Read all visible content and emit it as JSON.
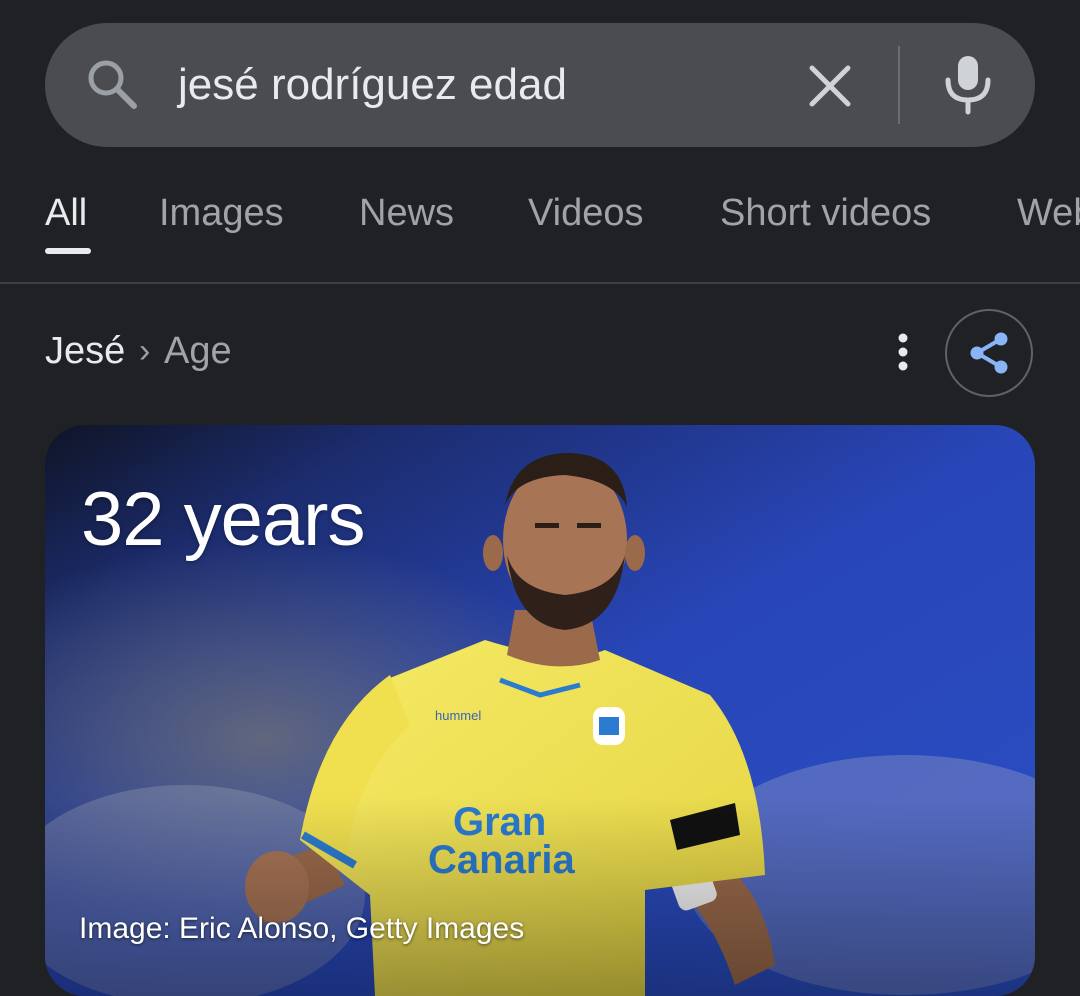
{
  "search": {
    "query": "jesé rodríguez edad",
    "icons": {
      "search": "search-icon",
      "clear": "close-icon",
      "voice": "mic-icon"
    }
  },
  "tabs": [
    {
      "label": "All",
      "active": true
    },
    {
      "label": "Images",
      "active": false
    },
    {
      "label": "News",
      "active": false
    },
    {
      "label": "Videos",
      "active": false
    },
    {
      "label": "Short videos",
      "active": false
    },
    {
      "label": "Web",
      "active": false
    }
  ],
  "result": {
    "breadcrumb": {
      "entity": "Jesé",
      "separator": "›",
      "attribute": "Age"
    },
    "actions": {
      "more": "more-vert-icon",
      "share": "share-icon"
    },
    "answer": "32 years",
    "image_credit": "Image: Eric Alonso, Getty Images"
  },
  "colors": {
    "background": "#202124",
    "search_bar": "#4a4c50",
    "share_icon": "#8ab4f8",
    "jersey": "#f3e45a",
    "jersey_text": "#2b7bd0"
  }
}
